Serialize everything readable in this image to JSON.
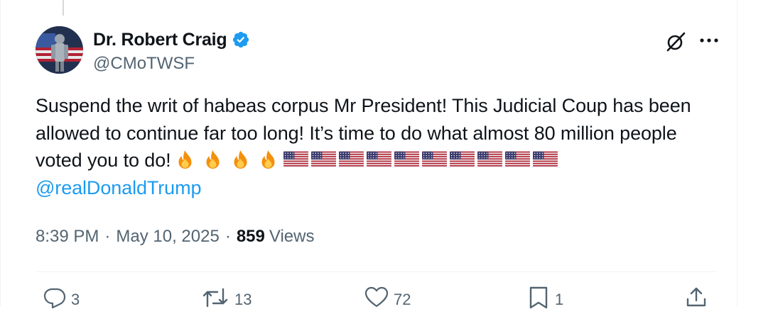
{
  "author": {
    "display_name": "Dr. Robert Craig",
    "handle": "@CMoTWSF"
  },
  "tweet": {
    "text_line_1": "Suspend the writ of habeas corpus Mr President! This Judicial Coup has been allowed to continue far too long! It’s time to do what almost 80 million people voted you to do!",
    "mention": "@realDonaldTrump",
    "emojis": [
      "fire",
      "fire",
      "fire",
      "fire",
      "us-flag",
      "us-flag",
      "us-flag",
      "us-flag",
      "us-flag",
      "us-flag",
      "us-flag",
      "us-flag",
      "us-flag",
      "us-flag"
    ]
  },
  "meta": {
    "time": "8:39 PM",
    "separator": "·",
    "date": "May 10, 2025",
    "views_count": "859",
    "views_label": "Views"
  },
  "actions": {
    "replies": "3",
    "reposts": "13",
    "likes": "72",
    "bookmarks": "1"
  },
  "colors": {
    "accent": "#1d9bf0",
    "secondary_text": "#536471",
    "primary_text": "#0f1419"
  }
}
